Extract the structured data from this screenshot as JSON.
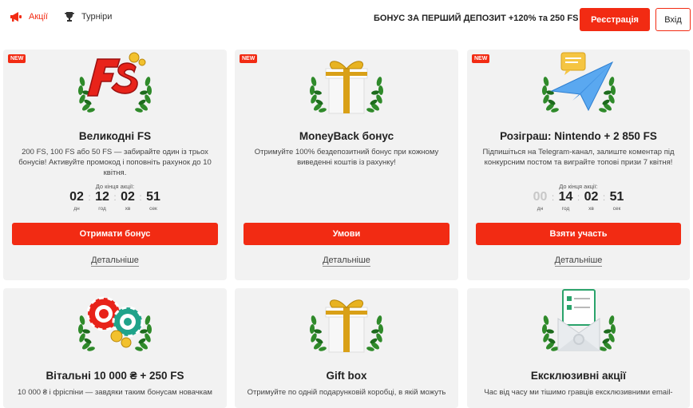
{
  "header": {
    "nav": [
      {
        "label": "Акції",
        "icon": "megaphone-icon"
      },
      {
        "label": "Турніри",
        "icon": "trophy-icon"
      }
    ],
    "bonus_text": "БОНУС ЗА ПЕРШИЙ ДЕПОЗИТ +120% та 250 FS",
    "register_label": "Реєстрація",
    "login_label": "Вхід"
  },
  "colors": {
    "accent": "#f22b13",
    "card_bg": "#f2f2f2"
  },
  "promos": [
    {
      "badge": "NEW",
      "image": "fs-logo-wreath",
      "title": "Великодні FS",
      "desc": "200 FS, 100 FS або 50 FS — забирайте один із трьох бонусів! Активуйте промокод і поповніть рахунок до 10 квітня.",
      "timer_label": "До кінця акції:",
      "timer": {
        "d": "02",
        "h": "12",
        "m": "02",
        "s": "51"
      },
      "button": "Отримати бонус",
      "details": "Детальніше"
    },
    {
      "badge": "NEW",
      "image": "gift-box-wreath",
      "title": "MoneyBack бонус",
      "desc": "Отримуйте 100% бездепозитний бонус при кожному виведенні коштів із рахунку!",
      "button": "Умови",
      "details": "Детальніше"
    },
    {
      "badge": "NEW",
      "image": "paper-plane-wreath",
      "title": "Розіграш: Nintendo + 2 850 FS",
      "desc": "Підпишіться на Telegram-канал, залиште коментар під конкурсним постом та виграйте топові призи 7 квітня!",
      "timer_label": "До кінця акції:",
      "timer": {
        "d": "00",
        "h": "14",
        "m": "02",
        "s": "51"
      },
      "button": "Взяти участь",
      "details": "Детальніше"
    },
    {
      "image": "casino-chips-wreath",
      "title": "Вітальні 10 000 ₴ + 250 FS",
      "desc": "10 000 ₴ і фріспіни — завдяки таким бонусам новачкам"
    },
    {
      "image": "gift-box-wreath",
      "title": "Gift box",
      "desc": "Отримуйте по одній подарунковій коробці, в якій можуть"
    },
    {
      "image": "envelope-checklist-wreath",
      "title": "Ексклюзивні акції",
      "desc": "Час від часу ми тішимо гравців ексклюзивними email-"
    }
  ],
  "timer_units": {
    "d": "дн",
    "h": "год",
    "m": "хв",
    "s": "сек"
  }
}
